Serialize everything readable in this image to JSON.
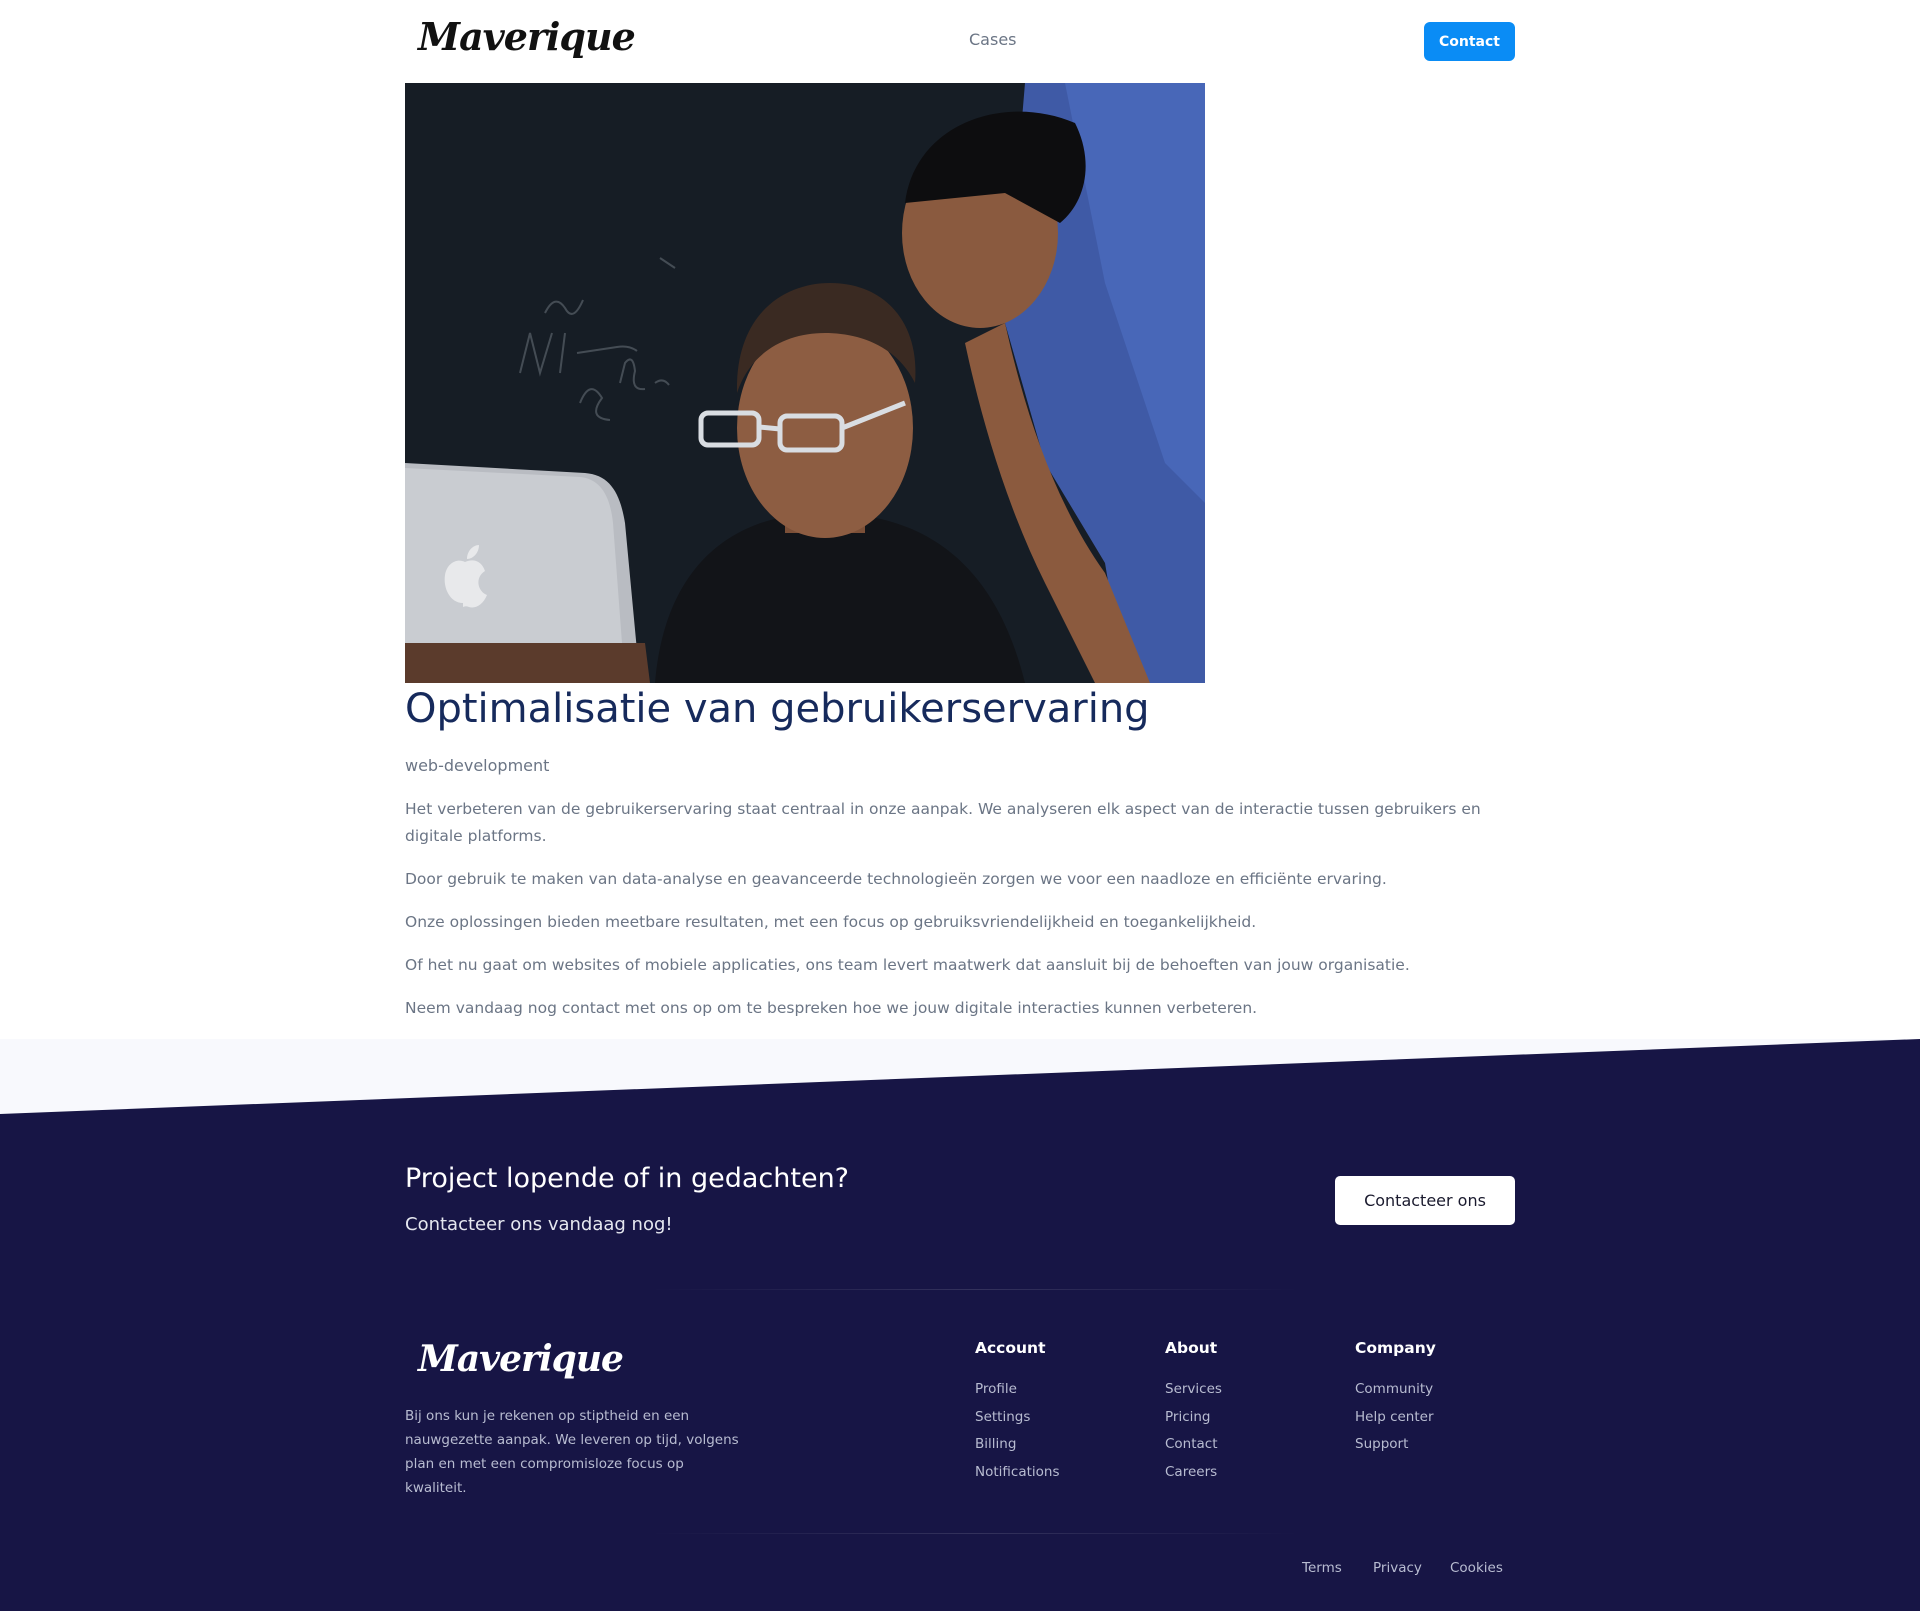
{
  "header": {
    "logo_text": "Maverique",
    "nav_items": [
      "Cases"
    ],
    "contact_label": "Contact",
    "accent_color": "#0a8cf5"
  },
  "article": {
    "title": "Optimalisatie van gebruikerservaring",
    "category": "web-development",
    "paragraphs": [
      "Het verbeteren van de gebruikerservaring staat centraal in onze aanpak. We analyseren elk aspect van de interactie tussen gebruikers en digitale platforms.",
      "Door gebruik te maken van data-analyse en geavanceerde technologieën zorgen we voor een naadloze en efficiënte ervaring.",
      "Onze oplossingen bieden meetbare resultaten, met een focus op gebruiksvriendelijkheid en toegankelijkheid.",
      "Of het nu gaat om websites of mobiele applicaties, ons team levert maatwerk dat aansluit bij de behoeften van jouw organisatie.",
      "Neem vandaag nog contact met ons op om te bespreken hoe we jouw digitale interacties kunnen verbeteren."
    ],
    "title_color": "#162a5c"
  },
  "cta": {
    "title": "Project lopende of in gedachten?",
    "subtitle": "Contacteer ons vandaag nog!",
    "button_label": "Contacteer ons"
  },
  "footer": {
    "logo_text": "Maverique",
    "description": "Bij ons kun je rekenen op stiptheid en een nauwgezette aanpak. We leveren op tijd, volgens plan en met een compromisloze focus op kwaliteit.",
    "columns": [
      {
        "heading": "Account",
        "links": [
          "Profile",
          "Settings",
          "Billing",
          "Notifications"
        ]
      },
      {
        "heading": "About",
        "links": [
          "Services",
          "Pricing",
          "Contact",
          "Careers"
        ]
      },
      {
        "heading": "Company",
        "links": [
          "Community",
          "Help center",
          "Support"
        ]
      }
    ],
    "bottom_links": [
      "Terms",
      "Privacy",
      "Cookies"
    ],
    "background_color": "#171545"
  }
}
